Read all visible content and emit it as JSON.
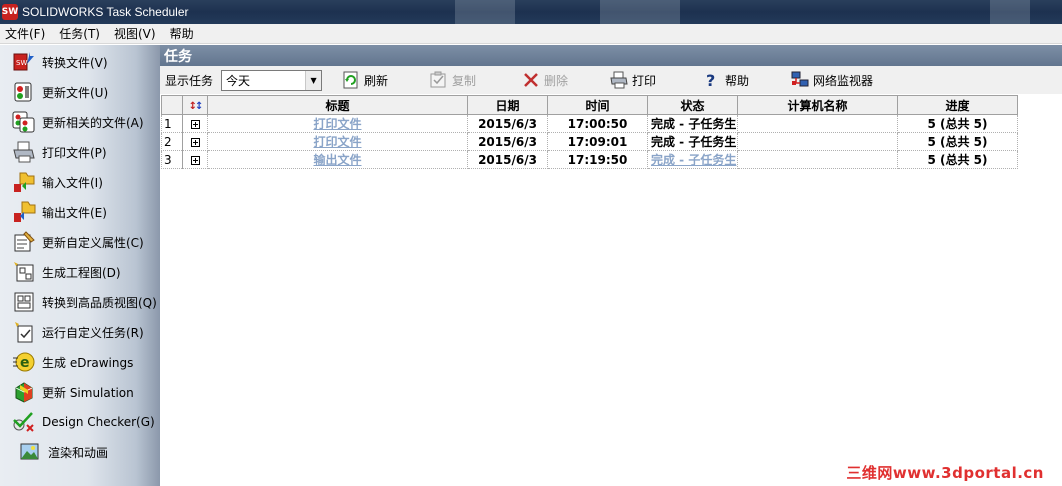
{
  "window": {
    "title": "SOLIDWORKS Task Scheduler",
    "app_icon": "SW"
  },
  "menu": [
    "文件(F)",
    "任务(T)",
    "视图(V)",
    "帮助"
  ],
  "sidebar": {
    "items": [
      {
        "label": "转换文件(V)",
        "icon": "convert-files-icon"
      },
      {
        "label": "更新文件(U)",
        "icon": "update-files-icon"
      },
      {
        "label": "更新相关的文件(A)",
        "icon": "update-related-icon"
      },
      {
        "label": "打印文件(P)",
        "icon": "print-files-icon"
      },
      {
        "label": "输入文件(I)",
        "icon": "import-files-icon"
      },
      {
        "label": "输出文件(E)",
        "icon": "export-files-icon"
      },
      {
        "label": "更新自定义属性(C)",
        "icon": "custom-properties-icon"
      },
      {
        "label": "生成工程图(D)",
        "icon": "create-drawings-icon"
      },
      {
        "label": "转换到高品质视图(Q)",
        "icon": "high-quality-view-icon"
      },
      {
        "label": "运行自定义任务(R)",
        "icon": "run-custom-task-icon"
      },
      {
        "label": "生成 eDrawings",
        "icon": "edrawings-icon"
      },
      {
        "label": "更新 Simulation",
        "icon": "simulation-icon"
      },
      {
        "label": "Design Checker(G)",
        "icon": "design-checker-icon"
      },
      {
        "label": "渲染和动画",
        "icon": "render-animation-icon"
      }
    ]
  },
  "panel": {
    "title": "任务"
  },
  "toolbar": {
    "show_label": "显示任务",
    "filter_value": "今天",
    "refresh": "刷新",
    "copy": "复制",
    "delete": "删除",
    "print": "打印",
    "help": "帮助",
    "network_monitor": "网络监视器"
  },
  "table": {
    "columns": [
      "标题",
      "日期",
      "时间",
      "状态",
      "计算机名称",
      "进度"
    ],
    "rows": [
      {
        "num": "1",
        "title": "打印文件",
        "date": "2015/6/3",
        "time": "17:00:50",
        "status": "完成 - 子任务生",
        "computer": "",
        "progress": "5 (总共 5)"
      },
      {
        "num": "2",
        "title": "打印文件",
        "date": "2015/6/3",
        "time": "17:09:01",
        "status": "完成 - 子任务生",
        "computer": "",
        "progress": "5 (总共 5)"
      },
      {
        "num": "3",
        "title": "输出文件",
        "date": "2015/6/3",
        "time": "17:19:50",
        "status": "完成 - 子任务生",
        "computer": "",
        "progress": "5 (总共 5)"
      }
    ]
  },
  "watermark": "三维网www.3dportal.cn",
  "colors": {
    "link": "#8aa4c8",
    "header_bar": "#6f819a",
    "titlebar": "#1f3454"
  }
}
